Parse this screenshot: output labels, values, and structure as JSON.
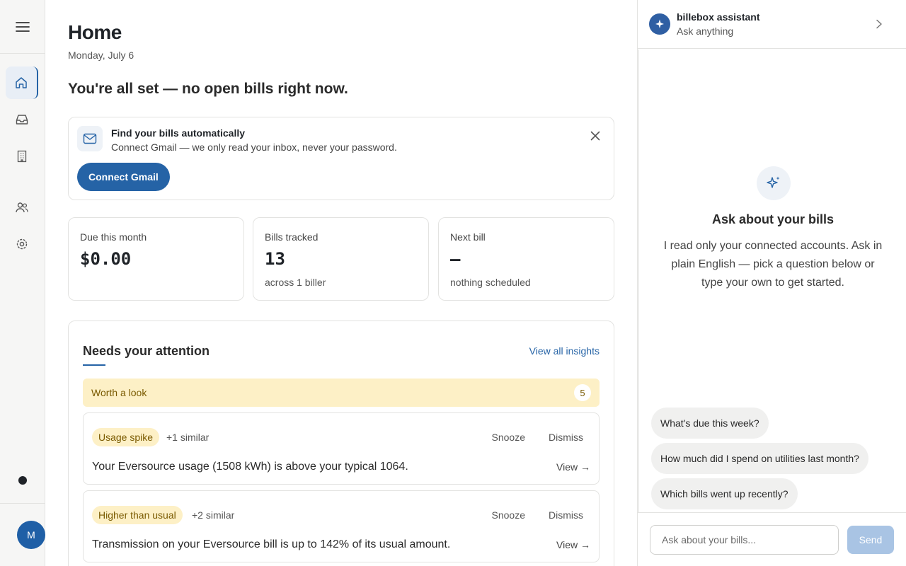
{
  "nav": {
    "items": [
      {
        "icon": "home-icon",
        "active": true
      },
      {
        "icon": "inbox-icon",
        "active": false
      },
      {
        "icon": "building-icon",
        "active": false
      },
      {
        "icon": "users-icon",
        "active": false
      },
      {
        "icon": "settings-icon",
        "active": false
      }
    ],
    "avatar_initial": "M"
  },
  "header": {
    "title": "Home",
    "date": "Monday, July 6"
  },
  "status_headline": "You're all set — no open bills right now.",
  "banner": {
    "title": "Find your bills automatically",
    "subtitle": "Connect Gmail — we only read your inbox, never your password.",
    "button_label": "Connect Gmail"
  },
  "stats": [
    {
      "label": "Due this month",
      "value": "$0.00",
      "note": ""
    },
    {
      "label": "Bills tracked",
      "value": "13",
      "note": "across 1 biller"
    },
    {
      "label": "Next bill",
      "value": "—",
      "note": "nothing scheduled"
    }
  ],
  "attention": {
    "title": "Needs your attention",
    "link_label": "View all insights",
    "group_label": "Worth a look",
    "group_count": "5",
    "items": [
      {
        "tag": "Usage spike",
        "similar": "+1 similar",
        "snooze": "Snooze",
        "dismiss": "Dismiss",
        "message": "Your Eversource usage (1508 kWh) is above your typical 1064.",
        "view": "View →"
      },
      {
        "tag": "Higher than usual",
        "similar": "+2 similar",
        "snooze": "Snooze",
        "dismiss": "Dismiss",
        "message": "Transmission on your Eversource bill is up to 142% of its usual amount.",
        "view": "View →"
      }
    ]
  },
  "assistant": {
    "name": "billebox assistant",
    "subtitle": "Ask anything",
    "empty_title": "Ask about your bills",
    "empty_desc": "I read only your connected accounts. Ask in plain English — pick a question below or type your own to get started.",
    "suggestions": [
      "What's due this week?",
      "How much did I spend on utilities last month?",
      "Which bills went up recently?"
    ],
    "input_placeholder": "Ask about your bills...",
    "send_label": "Send"
  },
  "colors": {
    "accent": "#2563a6",
    "warning_bg": "#fdf0c6",
    "warning_text": "#7a5a00",
    "send_disabled": "#a9c4e4"
  }
}
